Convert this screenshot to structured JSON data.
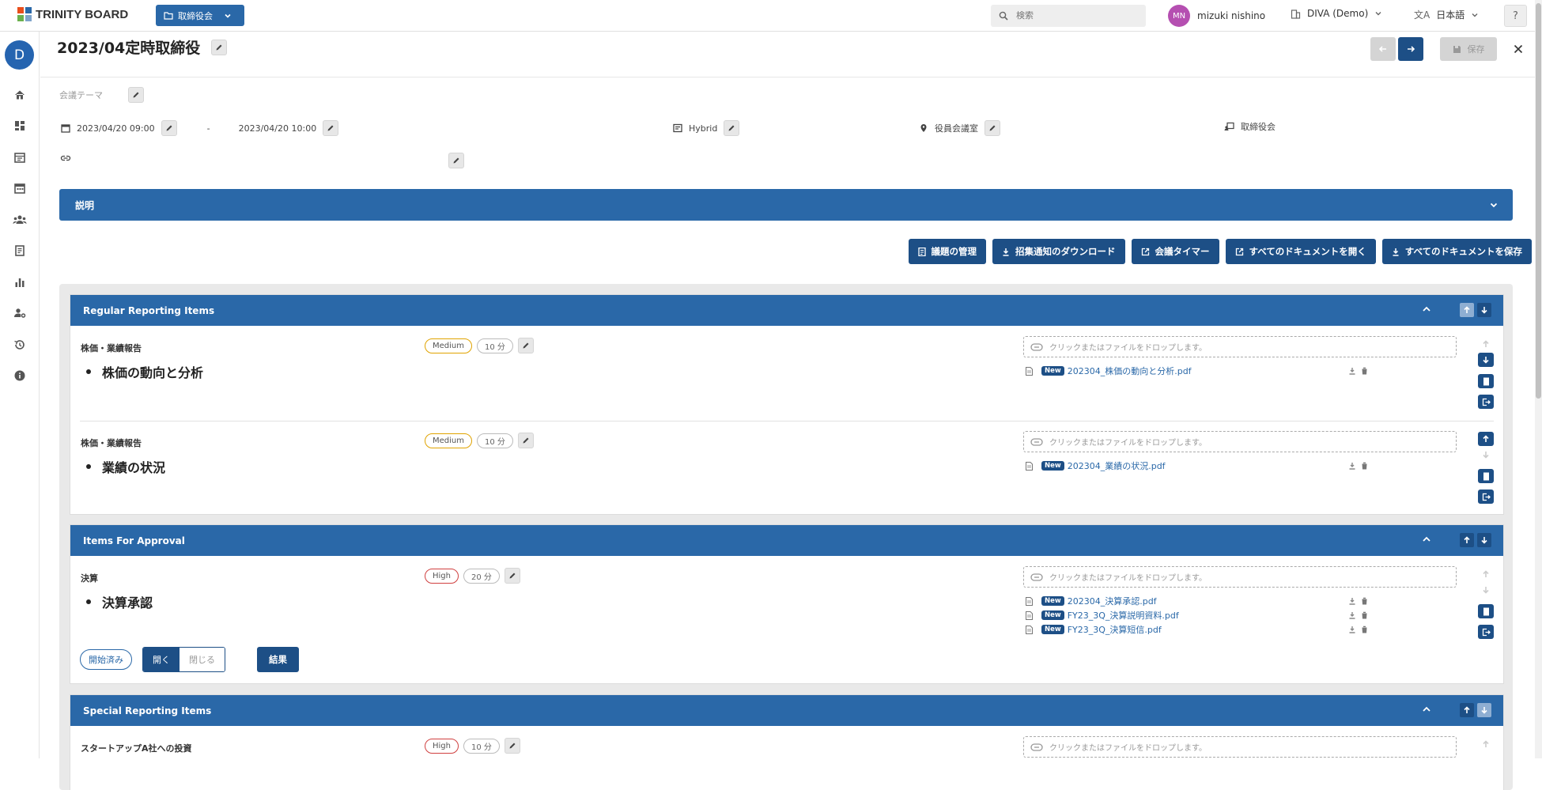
{
  "app": {
    "brand": "TRINITY BOARD",
    "brand_colors": [
      "#e94e1b",
      "#2a68a8",
      "#6ab04c"
    ]
  },
  "header": {
    "meeting_selector": "取締役会",
    "search_placeholder": "検索",
    "user_initials": "MN",
    "user_name": "mizuki nishino",
    "organization": "DIVA (Demo)",
    "language": "日本語",
    "help": "?"
  },
  "sidebar": {
    "workspace_initial": "D",
    "items": [
      "home-icon",
      "dashboard-icon",
      "schedule-icon",
      "calendar-icon",
      "group-icon",
      "document-icon",
      "chart-icon",
      "user-settings-icon",
      "history-icon",
      "info-icon"
    ]
  },
  "meeting": {
    "title": "2023/04定時取締役",
    "save_label": "保存",
    "theme_label": "会議テーマ",
    "start": "2023/04/20 09:00",
    "range_sep": "-",
    "end": "2023/04/20 10:00",
    "format": "Hybrid",
    "location": "役員会議室",
    "committee": "取締役会",
    "description_label": "説明"
  },
  "actions": [
    {
      "icon": "list-icon",
      "label": "議題の管理"
    },
    {
      "icon": "download-icon",
      "label": "招集通知のダウンロード"
    },
    {
      "icon": "open-external-icon",
      "label": "会議タイマー"
    },
    {
      "icon": "open-external-icon",
      "label": "すべてのドキュメントを開く"
    },
    {
      "icon": "download-icon",
      "label": "すべてのドキュメントを保存"
    }
  ],
  "drop_text": "クリックまたはファイルをドロップします。",
  "new_badge": "New",
  "sections": [
    {
      "title": "Regular Reporting Items",
      "items": [
        {
          "category": "株価・業績報告",
          "title": "株価の動向と分析",
          "priority": "Medium",
          "duration": "10 分",
          "files": [
            "202304_株価の動向と分析.pdf"
          ]
        },
        {
          "category": "株価・業績報告",
          "title": "業績の状況",
          "priority": "Medium",
          "duration": "10 分",
          "files": [
            "202304_業績の状況.pdf"
          ]
        }
      ]
    },
    {
      "title": "Items For Approval",
      "items": [
        {
          "category": "決算",
          "title": "決算承認",
          "priority": "High",
          "duration": "20 分",
          "files": [
            "202304_決算承認.pdf",
            "FY23_3Q_決算説明資料.pdf",
            "FY23_3Q_決算短信.pdf"
          ]
        }
      ],
      "status": {
        "started": "開始済み",
        "open": "開く",
        "closed": "閉じる",
        "result": "結果"
      }
    },
    {
      "title": "Special Reporting Items",
      "items": [
        {
          "category": "スタートアップA社への投資",
          "priority": "High",
          "duration": "10 分"
        }
      ]
    }
  ],
  "colors": {
    "primary": "#2a68a8",
    "dark": "#1d4f86",
    "medium": "#e0a300",
    "high": "#d04040"
  }
}
